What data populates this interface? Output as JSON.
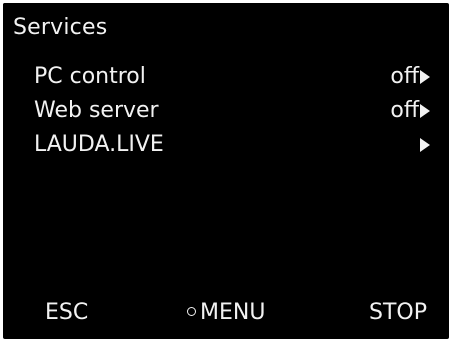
{
  "screen": {
    "title": "Services"
  },
  "menu": {
    "items": [
      {
        "label": "PC control",
        "value": "off",
        "icon": "arrow-right-icon"
      },
      {
        "label": "Web server",
        "value": "off",
        "icon": "arrow-right-icon"
      },
      {
        "label": "LAUDA.LIVE",
        "value": "",
        "icon": "arrow-right-icon"
      }
    ]
  },
  "softkeys": {
    "left": "ESC",
    "center": "MENU",
    "center_icon": "circle-icon",
    "right": "STOP"
  },
  "colors": {
    "background": "#000000",
    "text": "#f2f2f2"
  }
}
